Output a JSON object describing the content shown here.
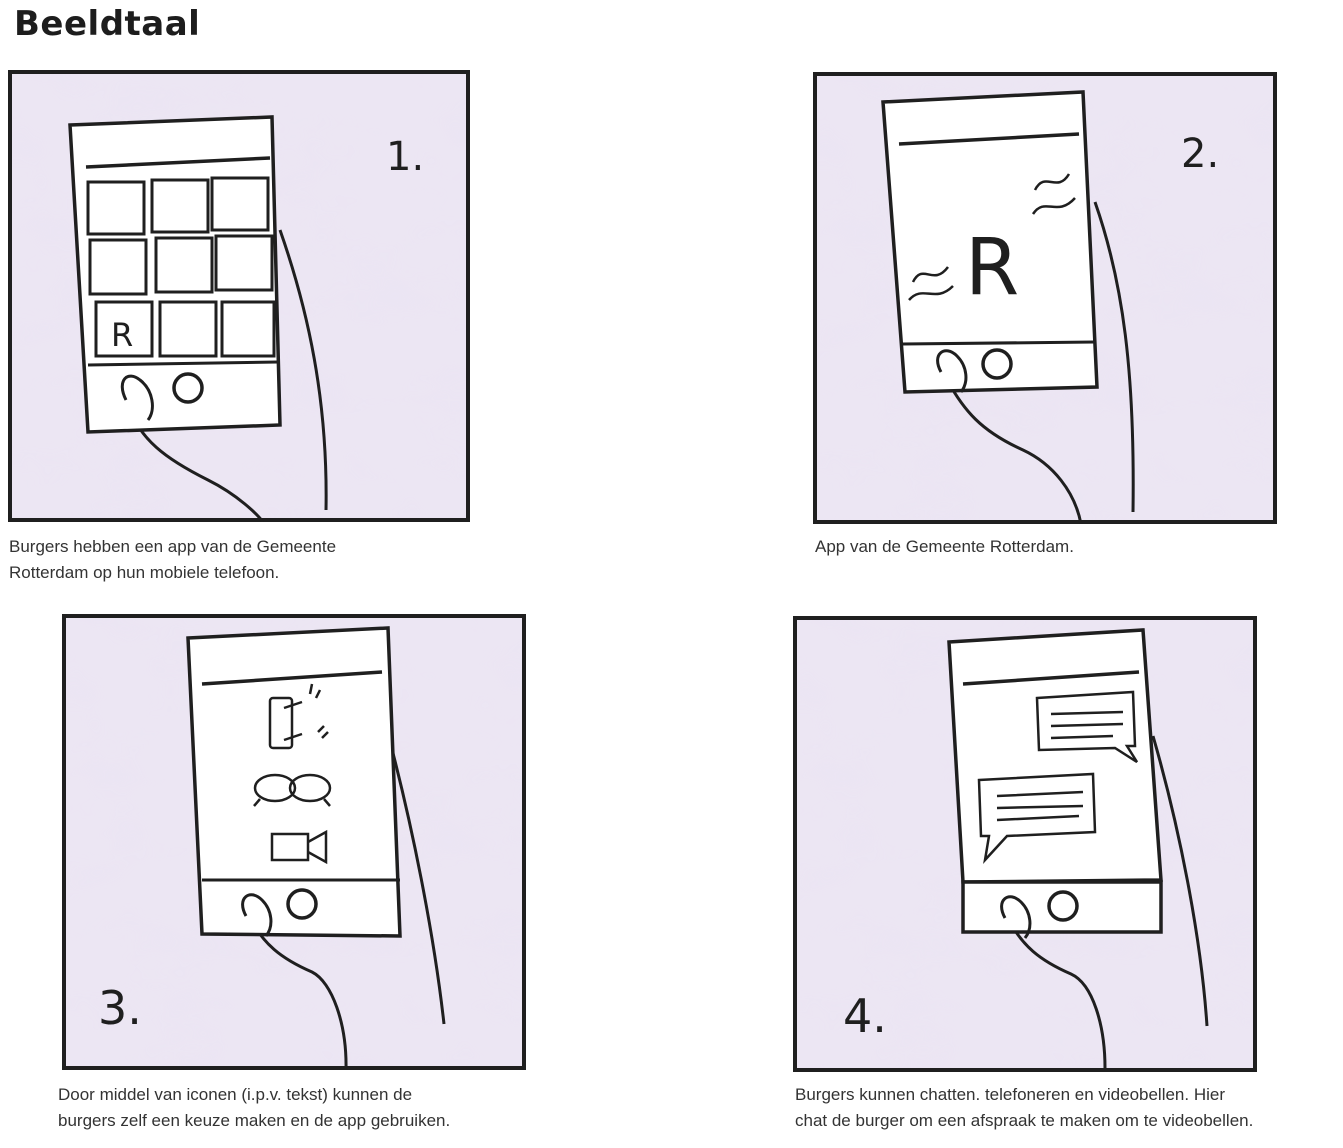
{
  "page": {
    "title": "Beeldtaal"
  },
  "panels": [
    {
      "number": "1.",
      "screen_letter": "R",
      "caption_lines": [
        "Burgers hebben een app van de Gemeente",
        "Rotterdam op hun mobiele telefoon."
      ]
    },
    {
      "number": "2.",
      "screen_letter": "R",
      "caption_lines": [
        "App van de Gemeente Rotterdam."
      ]
    },
    {
      "number": "3.",
      "icons": [
        "phone-icon",
        "chat-bubbles-icon",
        "video-camera-icon"
      ],
      "caption_lines": [
        "Door middel van iconen (i.p.v. tekst) kunnen de",
        "burgers zelf een keuze maken en de app gebruiken."
      ]
    },
    {
      "number": "4.",
      "icons": [
        "message-bubble-icon",
        "message-bubble-icon"
      ],
      "caption_lines": [
        "Burgers kunnen chatten. telefoneren en videobellen. Hier",
        "chat de burger om een afspraak te maken om te videobellen."
      ]
    }
  ],
  "colors": {
    "wash": "#e6def0",
    "wash_dark": "#d3c6e2",
    "ink": "#1f1f1f"
  }
}
